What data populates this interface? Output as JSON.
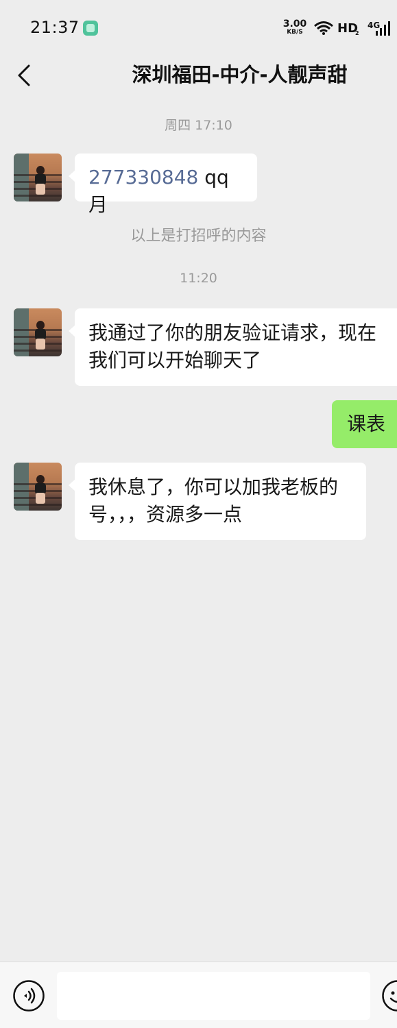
{
  "status_bar": {
    "time": "21:37",
    "net_speed_value": "3.00",
    "net_speed_unit": "KB/S",
    "hd_label": "HD",
    "hd_sub": "2",
    "network_type": "4G"
  },
  "header": {
    "title": "深圳福田-中介-人靓声甜"
  },
  "messages": [
    {
      "type": "timestamp",
      "text": "周四 17:10"
    },
    {
      "type": "incoming",
      "link_text": "277330848",
      "text": " qq 月"
    },
    {
      "type": "system",
      "text": "以上是打招呼的内容"
    },
    {
      "type": "timestamp",
      "text": "11:20"
    },
    {
      "type": "incoming",
      "text": "我通过了你的朋友验证请求，现在我们可以开始聊天了"
    },
    {
      "type": "outgoing",
      "text": "课表"
    },
    {
      "type": "incoming",
      "text": "我休息了，你可以加我老板的号，，，资源多一点"
    }
  ],
  "input_bar": {
    "placeholder": ""
  },
  "colors": {
    "background": "#ededed",
    "outgoing_bubble": "#95ec69",
    "incoming_bubble": "#ffffff",
    "link": "#576b95"
  }
}
